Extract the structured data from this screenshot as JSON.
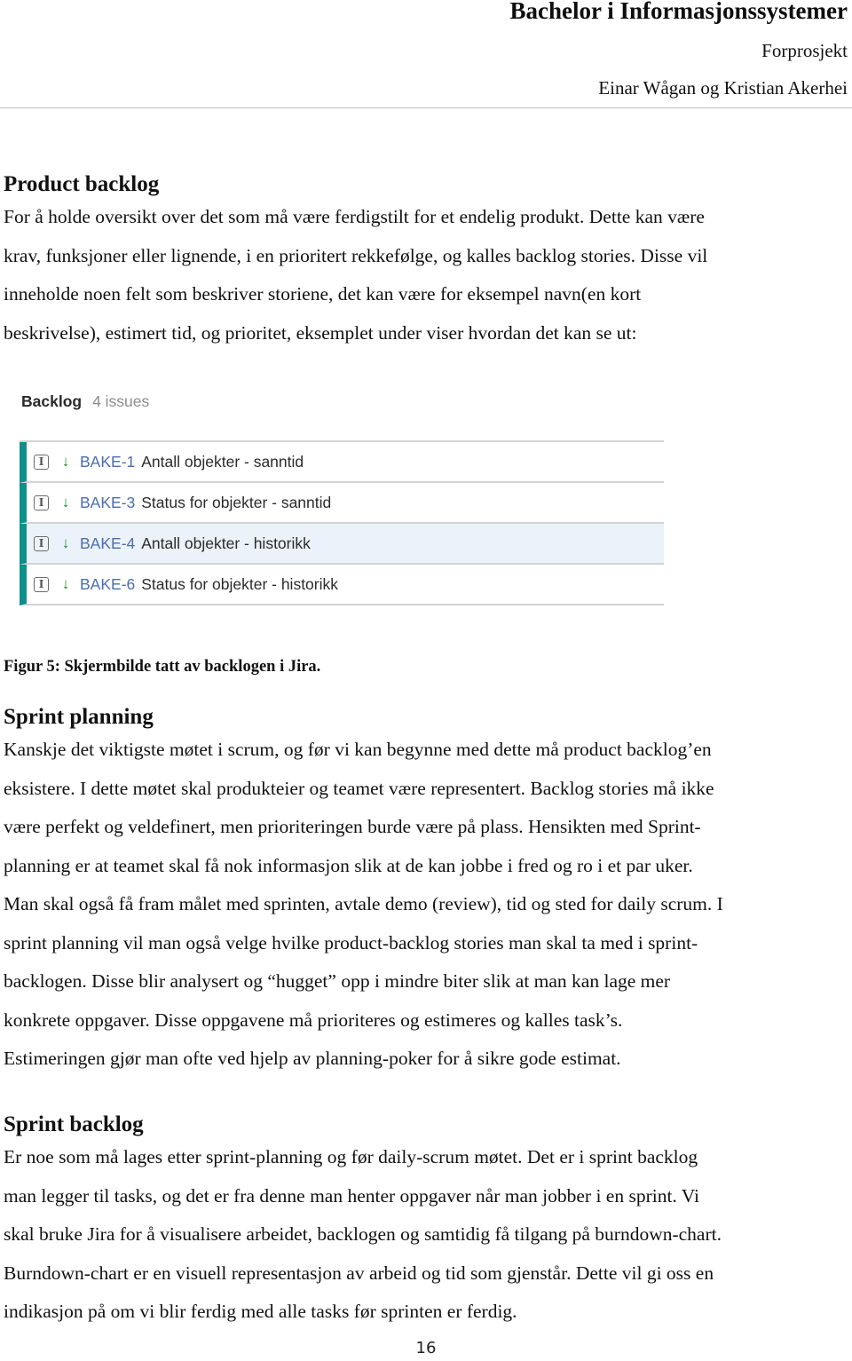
{
  "header": {
    "title": "Bachelor i Informasjonssystemer",
    "subtitle": "Forprosjekt",
    "authors": "Einar Wågan og Kristian Akerhei"
  },
  "sections": {
    "product_backlog": {
      "heading": "Product backlog",
      "lines": [
        "For å holde oversikt over det som må være ferdigstilt for et endelig produkt. Dette kan være",
        "krav, funksjoner eller lignende, i en prioritert rekkefølge, og kalles backlog stories. Disse vil",
        "inneholde noen felt som beskriver storiene, det kan være for eksempel navn(en kort",
        "beskrivelse), estimert tid, og prioritet, eksemplet under viser hvordan det kan se ut:"
      ]
    },
    "sprint_planning": {
      "heading": "Sprint planning",
      "lines": [
        "Kanskje det viktigste møtet i scrum, og før vi kan begynne med dette må product backlog’en",
        "eksistere. I dette møtet skal produkteier og teamet være representert. Backlog stories må ikke",
        "være perfekt og veldefinert, men prioriteringen burde være på plass. Hensikten med Sprint-",
        "planning er at teamet skal få nok informasjon slik at de kan jobbe i fred og ro i et par uker.",
        "Man skal også få fram målet med sprinten, avtale demo (review), tid og sted for daily scrum. I",
        "sprint planning vil man også velge hvilke product-backlog stories man skal ta med i sprint-",
        "backlogen. Disse blir analysert og “hugget” opp i mindre biter slik at man kan lage mer",
        "konkrete oppgaver. Disse oppgavene må prioriteres og estimeres og kalles task’s.",
        "Estimeringen gjør man ofte ved hjelp av planning-poker for å sikre gode estimat."
      ]
    },
    "sprint_backlog": {
      "heading": "Sprint backlog",
      "lines": [
        "Er noe som må lages etter sprint-planning og før daily-scrum møtet. Det er i sprint backlog",
        "man legger til tasks, og det er fra denne man henter oppgaver når man jobber i en sprint. Vi",
        "skal bruke Jira for å visualisere arbeidet, backlogen og samtidig få tilgang på burndown-chart.",
        "Burndown-chart er en visuell representasjon av arbeid og tid som gjenstår. Dette vil gi oss en",
        "indikasjon på om vi blir ferdig med alle tasks før sprinten er ferdig."
      ]
    }
  },
  "figure": {
    "backlog_label": "Backlog",
    "issue_count": "4 issues",
    "issue_type_icon": "story-icon",
    "priority_icon": "arrow-down-icon",
    "priority_glyph": "↓",
    "type_glyph": "I",
    "issues": [
      {
        "key": "BAKE-1",
        "summary": "Antall objekter - sanntid",
        "selected": false
      },
      {
        "key": "BAKE-3",
        "summary": "Status for objekter - sanntid",
        "selected": false
      },
      {
        "key": "BAKE-4",
        "summary": "Antall objekter - historikk",
        "selected": true
      },
      {
        "key": "BAKE-6",
        "summary": "Status for objekter - historikk",
        "selected": false
      }
    ],
    "colors": {
      "accent_bar": "#0f8f8a",
      "issue_key": "#4a6eb0",
      "priority": "#1c8a2a",
      "selected_row": "#ebf2f9"
    },
    "caption": "Figur 5: Skjermbilde tatt av backlogen i Jira."
  },
  "footer": {
    "page_number": "16"
  }
}
